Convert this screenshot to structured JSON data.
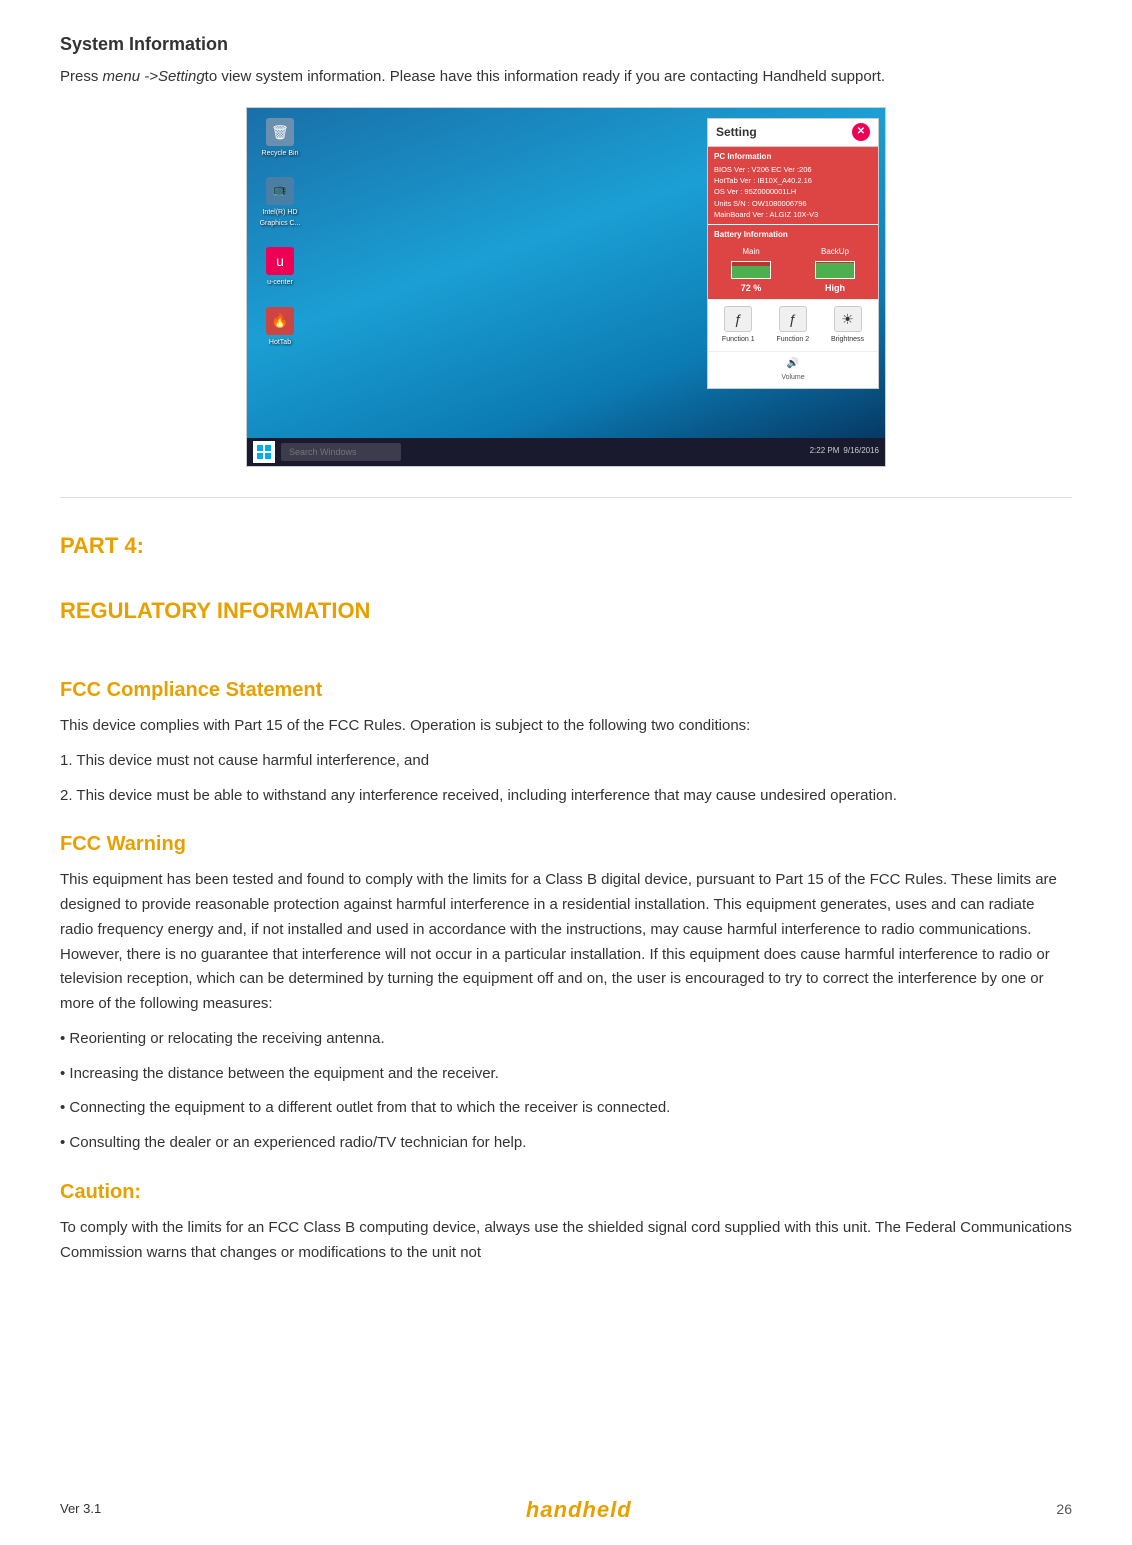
{
  "page": {
    "title": "System Information",
    "intro": {
      "prefix": "Press ",
      "italic_text": "menu ->Setting",
      "suffix": "to view system information. Please have this information ready if you are contacting Handheld support."
    }
  },
  "screenshot": {
    "desktop_icons": [
      {
        "label": "Recycle Bin",
        "icon": "🗑"
      },
      {
        "label": "Intel(R) HD Graphics C...",
        "icon": "📺"
      },
      {
        "label": "u-center",
        "icon": "🔵"
      },
      {
        "label": "HotTab",
        "icon": "📋"
      }
    ],
    "setting_panel": {
      "title": "Setting",
      "close_icon": "✕",
      "pc_info": {
        "title": "PC Information",
        "lines": [
          "BIOS Ver : V206    EC Ver :206",
          "HotTab Ver : IB10X_A40.2.16",
          "OS Ver : 95Z0000001LH",
          "Units S/N : OW1080006796",
          "MainBoard Ver : ALGIZ 10X-V3"
        ]
      },
      "battery_info": {
        "title": "Battery Information",
        "main_label": "Main",
        "backup_label": "BackUp",
        "main_value": "72 %",
        "main_fill_percent": 72,
        "backup_value": "High",
        "backup_fill_percent": 90
      },
      "buttons": [
        {
          "label": "Function 1",
          "icon": "ƒ"
        },
        {
          "label": "Function 2",
          "icon": "ƒ"
        },
        {
          "label": "Brightness",
          "icon": "☀"
        }
      ],
      "volume_icon": "🔊"
    },
    "taskbar": {
      "search_placeholder": "Search Windows",
      "time": "2:22 PM",
      "date": "9/16/2016"
    }
  },
  "part4": {
    "part_label": "PART 4:",
    "part_title": "REGULATORY INFORMATION"
  },
  "fcc_compliance": {
    "heading": "FCC Compliance Statement",
    "body": "This device complies with Part 15 of the FCC Rules. Operation is subject to the following two conditions:",
    "condition1": "1. This device must not cause harmful interference, and",
    "condition2": "2. This device must be able to withstand any interference received, including interference that may cause undesired operation."
  },
  "fcc_warning": {
    "heading": "FCC Warning",
    "body": "This equipment has been tested and found to comply with the limits for a Class B digital device, pursuant to Part 15 of the FCC Rules. These limits are designed to provide reasonable protection against harmful interference in a residential installation. This equipment generates, uses and can radiate radio frequency energy and, if not installed and used in accordance with the instructions, may cause harmful interference to radio communications. However, there is no guarantee that interference will not occur in a particular installation. If this equipment does cause harmful interference to radio or television reception, which can be determined by turning the equipment off and on, the user is encouraged to try to correct the interference by one or more of the following measures:",
    "bullets": [
      "• Reorienting or relocating the receiving antenna.",
      "•  Increasing the distance between the equipment and the receiver.",
      "• Connecting the equipment to a different outlet from that to which the receiver is connected.",
      "• Consulting the dealer or an experienced radio/TV technician for help."
    ]
  },
  "caution": {
    "heading": "Caution:",
    "body": "To comply with the limits for an FCC Class B computing device, always use the shielded signal cord supplied with this unit. The Federal Communications Commission warns that changes or modifications to the unit not"
  },
  "footer": {
    "version": "Ver 3.1",
    "brand": "handheld",
    "page_number": "26"
  }
}
